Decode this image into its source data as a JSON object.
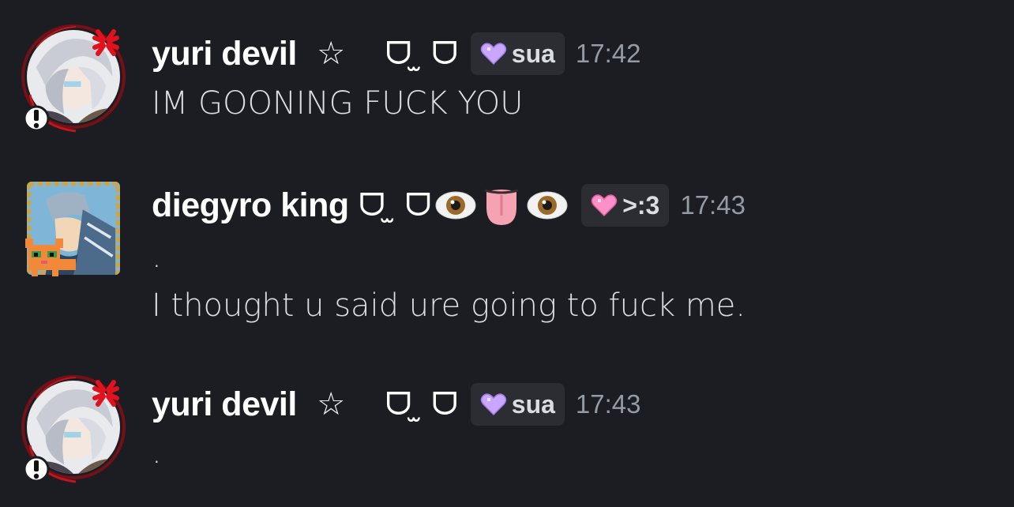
{
  "messages": [
    {
      "username": "yuri devil",
      "name_decoration": "  ☆    ᗜ ̫ ᗜ",
      "tag": "sua",
      "tag_color": "#c9a6ff",
      "time": "17:42",
      "lines": [
        "IM GOONING FUCK YOU"
      ],
      "avatar_icon": "white-haired-anime-avatar",
      "avatar_decoration": "anger-mark-and-exclamation-badge"
    },
    {
      "username": "diegyro king",
      "name_decoration": " ᗜ ̫ ᗜ",
      "name_emojis": [
        "eye-emoji",
        "tongue-emoji",
        "eye-emoji"
      ],
      "tag": ">:3",
      "tag_color": "#ff8fc8",
      "time": "17:43",
      "lines": [
        ".",
        "I thought u said ure going to fuck me."
      ],
      "avatar_icon": "armored-knight-avatar",
      "avatar_decoration": "pixel-cat-badge"
    },
    {
      "username": "yuri devil",
      "name_decoration": "  ☆    ᗜ ̫ ᗜ",
      "tag": "sua",
      "tag_color": "#c9a6ff",
      "time": "17:43",
      "lines": [
        "."
      ],
      "avatar_icon": "white-haired-anime-avatar",
      "avatar_decoration": "anger-mark-and-exclamation-badge"
    }
  ]
}
